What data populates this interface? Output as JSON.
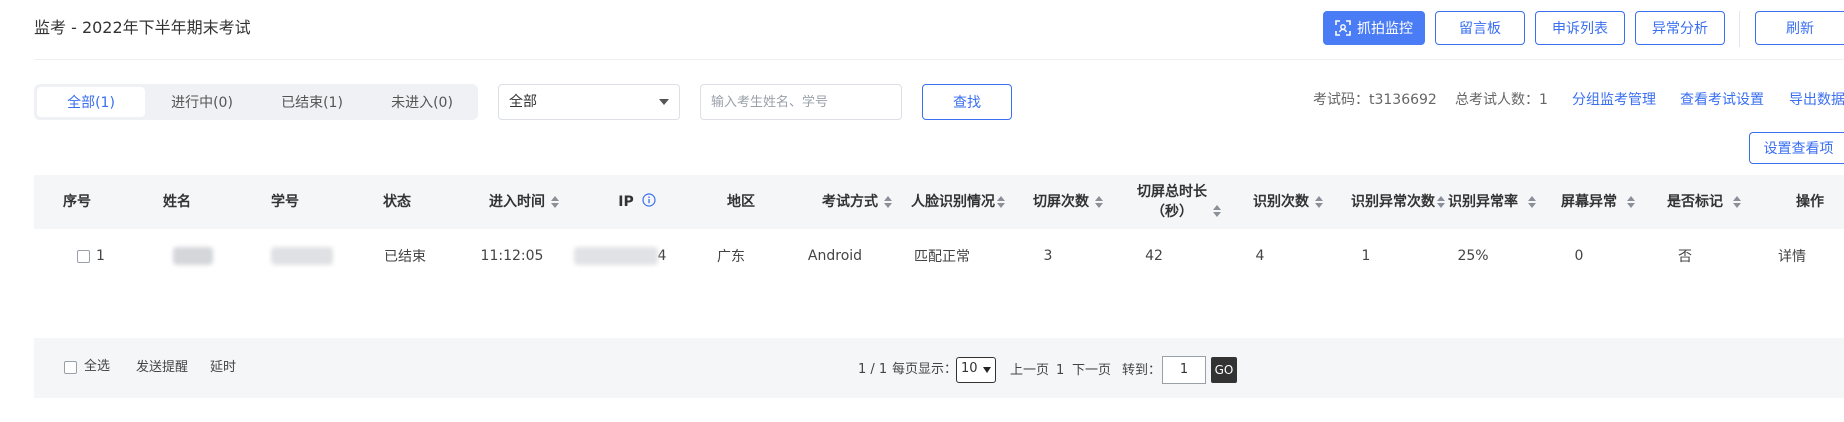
{
  "header": {
    "title": "监考 - 2022年下半年期末考试",
    "buttons": {
      "capture": "抓拍监控",
      "message_board": "留言板",
      "appeal_list": "申诉列表",
      "anomaly_analysis": "异常分析",
      "refresh": "刷新"
    }
  },
  "filters": {
    "tabs": [
      {
        "label": "全部(1)",
        "active": true
      },
      {
        "label": "进行中(0)",
        "active": false
      },
      {
        "label": "已结束(1)",
        "active": false
      },
      {
        "label": "未进入(0)",
        "active": false
      }
    ],
    "select_value": "全部",
    "search_placeholder": "输入考生姓名、学号",
    "search_button": "查找"
  },
  "info": {
    "exam_code": "考试码：t3136692",
    "total_examinees": "总考试人数：1",
    "group_proctor": "分组监考管理",
    "view_settings": "查看考试设置",
    "export": "导出数据",
    "set_view_items": "设置查看项"
  },
  "table": {
    "headers": [
      "序号",
      "姓名",
      "学号",
      "状态",
      "进入时间",
      "IP",
      "地区",
      "考试方式",
      "人脸识别情况",
      "切屏次数",
      "切屏总时长（秒）",
      "识别次数",
      "识别异常次数",
      "识别异常率",
      "屏幕异常",
      "是否标记",
      "操作"
    ],
    "header_lines": {
      "switch_duration_1": "切屏总时长",
      "switch_duration_2": "（秒）"
    },
    "rows": [
      {
        "index": "1",
        "status": "已结束",
        "enter_time": "11:12:05",
        "ip_suffix": "4",
        "region": "广东",
        "exam_mode": "Android",
        "face_recognition": "匹配正常",
        "switch_count": "3",
        "switch_duration": "42",
        "recognition_count": "4",
        "recognition_anomaly_count": "1",
        "recognition_anomaly_rate": "25%",
        "screen_anomaly": "0",
        "marked": "否",
        "action": "详情"
      }
    ]
  },
  "footer": {
    "select_all": "全选",
    "send_reminder": "发送提醒",
    "delay": "延时",
    "page_info": "1 / 1",
    "per_page_label": "每页显示：",
    "per_page_value": "10",
    "prev": "上一页",
    "current_page": "1",
    "next": "下一页",
    "goto_label": "转到：",
    "goto_value": "1",
    "go": "GO"
  },
  "colors": {
    "accent": "#4a7cf6",
    "link": "#3a6ff0",
    "header_bg": "#f5f6f8"
  }
}
